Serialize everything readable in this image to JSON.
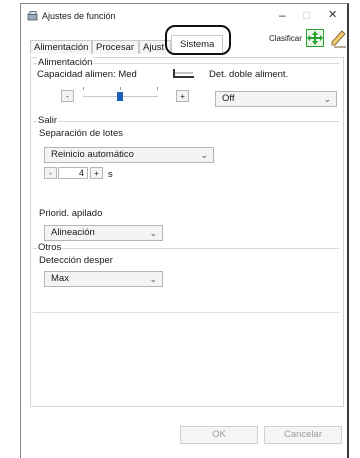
{
  "window": {
    "title": "Ajustes de función",
    "minimize": "–",
    "maximize": "□",
    "close": "✕"
  },
  "tabs": [
    {
      "label": "Alimentación"
    },
    {
      "label": "Procesar"
    },
    {
      "label": "Ajust"
    },
    {
      "label": "Sistema"
    }
  ],
  "toolbar": {
    "sort_label": "Clasificar"
  },
  "feed_group": {
    "title": "Alimentación",
    "capacity_label": "Capacidad alimen: Med",
    "minus": "-",
    "plus": "+",
    "double_feed_label": "Det. doble aliment.",
    "double_feed_value": "Off"
  },
  "output_group": {
    "title": "Salir",
    "batch_label": "Separación de lotes",
    "batch_value": "Reinicio automático",
    "minus": "-",
    "plus": "+",
    "seconds_value": "4",
    "seconds_unit": "s",
    "stack_label": "Priorid. apilado",
    "stack_value": "Alineación"
  },
  "other_group": {
    "title": "Otros",
    "skew_label": "Detección desper",
    "skew_value": "Max"
  },
  "footer": {
    "ok": "OK",
    "cancel": "Cancelar"
  },
  "colors": {
    "accent": "#1b5fbf",
    "sort_icon_green": "#2aa12a",
    "disabled_text": "#9c9c9c"
  }
}
